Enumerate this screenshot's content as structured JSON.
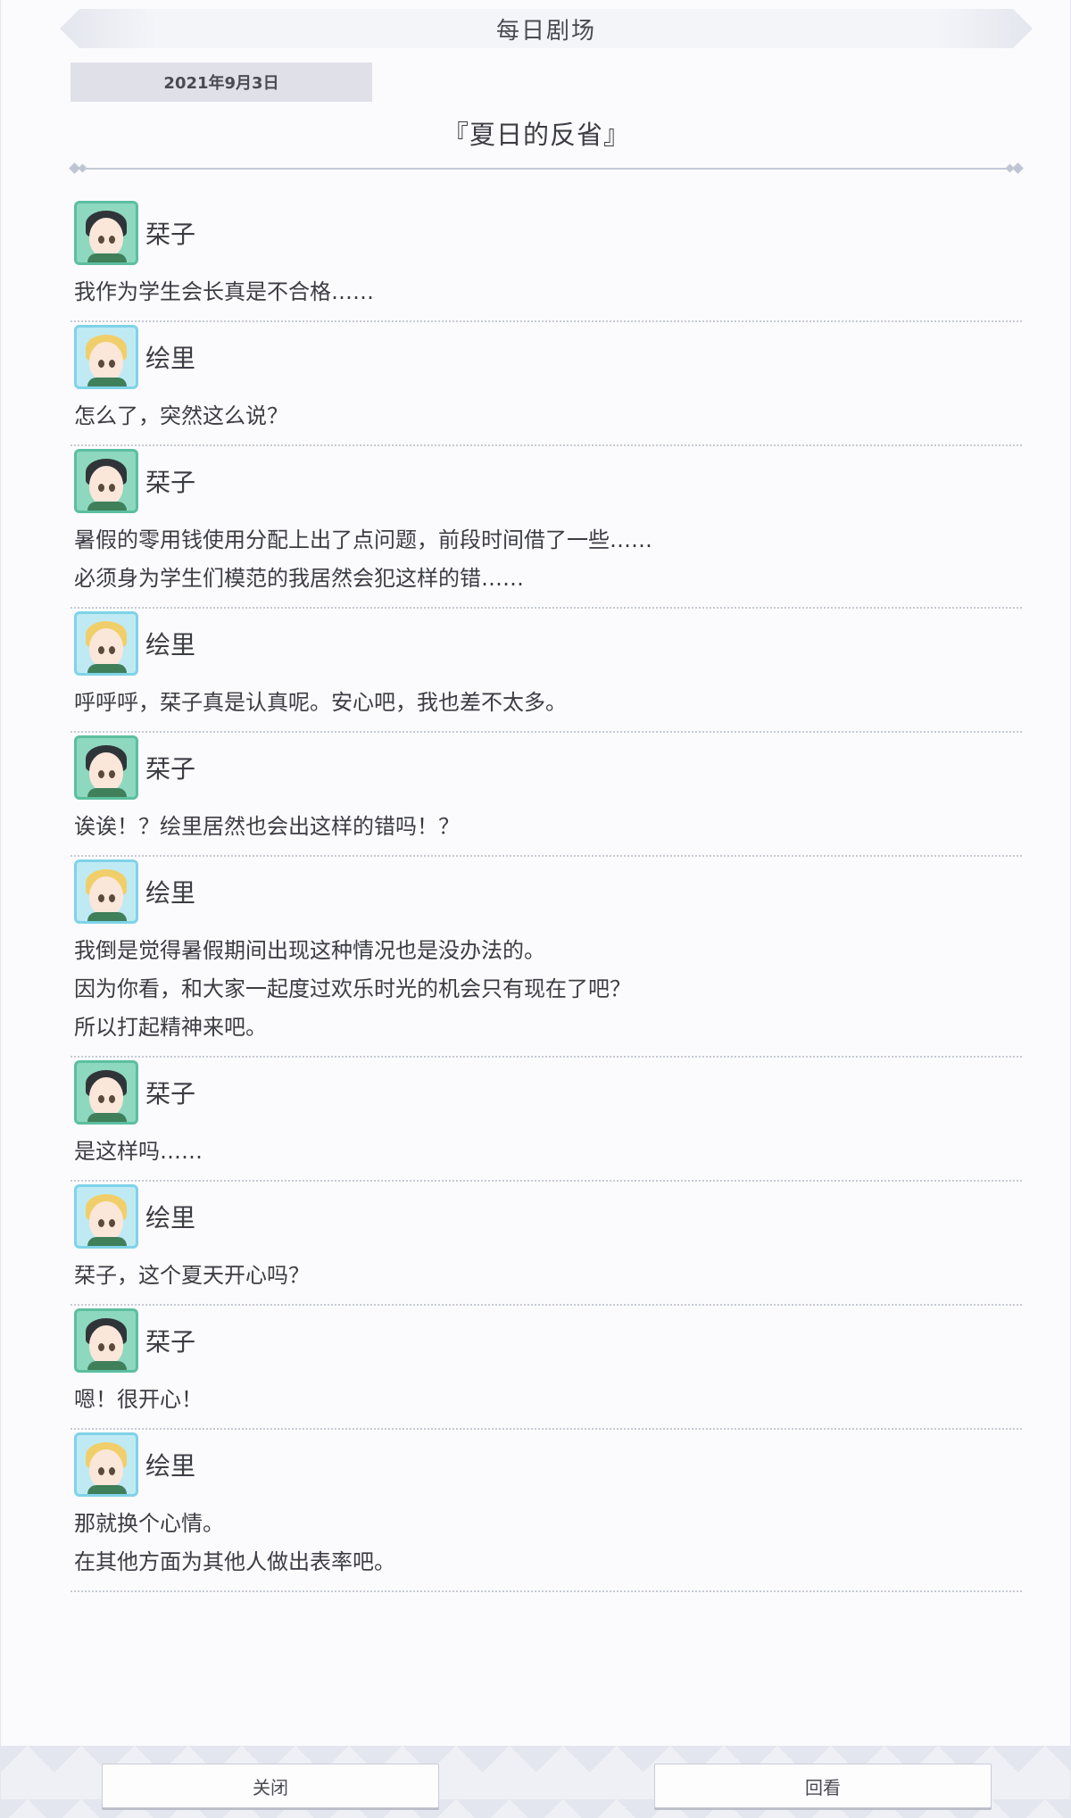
{
  "header": {
    "title": "每日剧场"
  },
  "date": "2021年9月3日",
  "story_title": "『夏日的反省』",
  "entries": [
    {
      "speaker": "栞子",
      "character": "kotoko",
      "lines": [
        "我作为学生会长真是不合格……"
      ]
    },
    {
      "speaker": "绘里",
      "character": "eri",
      "lines": [
        "怎么了，突然这么说？"
      ]
    },
    {
      "speaker": "栞子",
      "character": "kotoko",
      "lines": [
        "暑假的零用钱使用分配上出了点问题，前段时间借了一些……",
        "必须身为学生们模范的我居然会犯这样的错……"
      ]
    },
    {
      "speaker": "绘里",
      "character": "eri",
      "lines": [
        "呼呼呼，栞子真是认真呢。安心吧，我也差不太多。"
      ]
    },
    {
      "speaker": "栞子",
      "character": "kotoko",
      "lines": [
        "诶诶！？绘里居然也会出这样的错吗！？"
      ]
    },
    {
      "speaker": "绘里",
      "character": "eri",
      "lines": [
        "我倒是觉得暑假期间出现这种情况也是没办法的。",
        "因为你看，和大家一起度过欢乐时光的机会只有现在了吧？",
        "所以打起精神来吧。"
      ]
    },
    {
      "speaker": "栞子",
      "character": "kotoko",
      "lines": [
        "是这样吗……"
      ]
    },
    {
      "speaker": "绘里",
      "character": "eri",
      "lines": [
        "栞子，这个夏天开心吗？"
      ]
    },
    {
      "speaker": "栞子",
      "character": "kotoko",
      "lines": [
        "嗯！很开心！"
      ]
    },
    {
      "speaker": "绘里",
      "character": "eri",
      "lines": [
        "那就换个心情。",
        "在其他方面为其他人做出表率吧。"
      ]
    }
  ],
  "footer": {
    "close_label": "关闭",
    "review_label": "回看"
  },
  "colors": {
    "kotoko_frame": "#5cbf9f",
    "eri_frame": "#7fd3e8",
    "divider": "#c5cad6"
  }
}
